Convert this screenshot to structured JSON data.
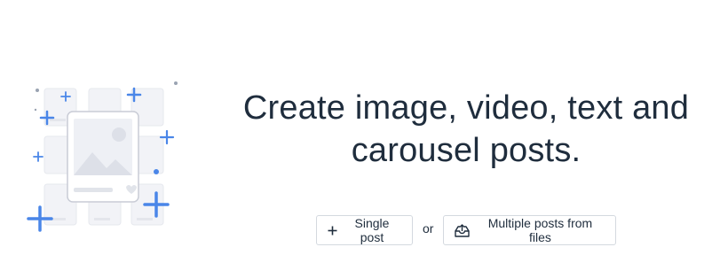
{
  "main": {
    "headline_line1": "Create image, video, text and",
    "headline_line2": "carousel posts."
  },
  "actions": {
    "single_post_label": "Single post",
    "separator_text": "or",
    "multiple_posts_label": "Multiple posts from files"
  },
  "icons": {
    "single_post": "plus-icon",
    "multiple_posts": "upload-tray-icon",
    "illustration": "post-grid-illustration"
  },
  "colors": {
    "text": "#1f2d3d",
    "accent": "#4a86e8",
    "border": "#d4d9df",
    "placeholder": "#eef0f5"
  }
}
